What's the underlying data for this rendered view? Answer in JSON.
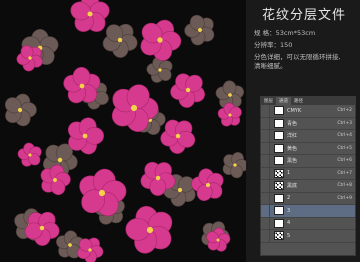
{
  "info": {
    "title": "花纹分层文件",
    "size_line": "规 格：53cm*53cm",
    "resolution_line": "分辨率：150",
    "desc_line1": "分色详细，可以无限循环拼接,",
    "desc_line2": "清晰细腻。"
  },
  "layers_panel": {
    "tabs": [
      "图层",
      "通道",
      "路径"
    ],
    "rows": [
      {
        "name": "CMYK",
        "fx": "Ctrl+2",
        "thumb": "white",
        "selected": false
      },
      {
        "name": "青色",
        "fx": "Ctrl+3",
        "thumb": "white",
        "selected": false
      },
      {
        "name": "洋红",
        "fx": "Ctrl+4",
        "thumb": "white",
        "selected": false
      },
      {
        "name": "黄色",
        "fx": "Ctrl+5",
        "thumb": "white",
        "selected": false
      },
      {
        "name": "黑色",
        "fx": "Ctrl+6",
        "thumb": "white",
        "selected": false
      },
      {
        "name": "1",
        "fx": "Ctrl+7",
        "thumb": "pattern",
        "selected": false
      },
      {
        "name": "黑底",
        "fx": "Ctrl+8",
        "thumb": "pattern",
        "selected": false
      },
      {
        "name": "2",
        "fx": "Ctrl+9",
        "thumb": "white",
        "selected": false
      },
      {
        "name": "3",
        "fx": "",
        "thumb": "white",
        "selected": true
      },
      {
        "name": "4",
        "fx": "",
        "thumb": "white",
        "selected": false
      },
      {
        "name": "5",
        "fx": "",
        "thumb": "pattern",
        "selected": false
      }
    ]
  },
  "colors": {
    "background": "#0b0b0b",
    "flower_pink": "#d63a8e",
    "flower_pink_dark": "#a8246a",
    "flower_gray": "#6b5a55",
    "center_yellow": "#f3d24a"
  }
}
